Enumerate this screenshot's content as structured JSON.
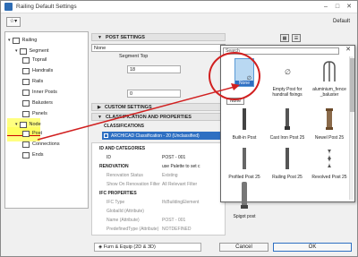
{
  "window": {
    "title": "Railing Default Settings",
    "default_label": "Default",
    "minimize": "–",
    "maximize": "□",
    "close": "✕"
  },
  "tree": {
    "items": [
      {
        "label": "Railing",
        "level": 0
      },
      {
        "label": "Segment",
        "level": 1
      },
      {
        "label": "Toprail",
        "level": 2
      },
      {
        "label": "Handrails",
        "level": 2
      },
      {
        "label": "Rails",
        "level": 2
      },
      {
        "label": "Inner Posts",
        "level": 2
      },
      {
        "label": "Balusters",
        "level": 2
      },
      {
        "label": "Panels",
        "level": 2
      },
      {
        "label": "Node",
        "level": 1
      },
      {
        "label": "Post",
        "level": 2
      },
      {
        "label": "Connections",
        "level": 2
      },
      {
        "label": "Ends",
        "level": 2
      }
    ]
  },
  "main": {
    "post_settings": "POST SETTINGS",
    "selected_post": "None",
    "segment_top_label": "Segment Top",
    "segment_top_value": "18",
    "offset_value": "0",
    "custom_settings": "CUSTOM SETTINGS",
    "classification_header": "CLASSIFICATION AND PROPERTIES",
    "classifications_label": "CLASSIFICATIONS",
    "classification_value": "ARCHICAD Classification - 20 (Unclassified)",
    "properties": [
      {
        "key": "ID AND CATEGORIES",
        "value": "",
        "type": "hd"
      },
      {
        "key": "ID",
        "value": "POST - 001",
        "type": "dark"
      },
      {
        "key": "RENOVATION",
        "value": "use Palette to set c",
        "type": "hd"
      },
      {
        "key": "Renovation Status",
        "value": "Existing",
        "type": "gray"
      },
      {
        "key": "Show On Renovation Filter",
        "value": "All Relevant Filter",
        "type": "gray"
      },
      {
        "key": "IFC PROPERTIES",
        "value": "",
        "type": "hd"
      },
      {
        "key": "IFC Type",
        "value": "IfcBuildingElement",
        "type": "gray"
      },
      {
        "key": "GlobalId (Attribute)",
        "value": "",
        "type": "gray"
      },
      {
        "key": "Name (Attribute)",
        "value": "POST - 001",
        "type": "gray"
      },
      {
        "key": "PredefinedType (Attribute)",
        "value": "NOTDEFINED",
        "type": "gray"
      }
    ]
  },
  "bottom": {
    "layer": "Furn & Equip (2D & 3D)",
    "cancel": "Cancel",
    "ok": "OK"
  },
  "library_popup": {
    "search_placeholder": "Search",
    "close": "✕",
    "tooltip": "None",
    "items": [
      {
        "label": "None",
        "icon": "none-icon"
      },
      {
        "label": "Empty Post for handrail fixings",
        "icon": "empty-post-icon"
      },
      {
        "label": "aluminium_fence _baluster",
        "icon": "baluster-icon"
      },
      {
        "label": "Built-in Post",
        "icon": "builtin-post-icon"
      },
      {
        "label": "Cast Iron Post 25",
        "icon": "cast-iron-post-icon"
      },
      {
        "label": "Newel Post 25",
        "icon": "newel-post-icon"
      },
      {
        "label": "Profiled Post 25",
        "icon": "profiled-post-icon"
      },
      {
        "label": "Railing Post 25",
        "icon": "railing-post-icon"
      },
      {
        "label": "Revolved Post 25",
        "icon": "revolved-post-icon"
      },
      {
        "label": "Spigot post",
        "icon": "spigot-post-icon"
      }
    ]
  },
  "colors": {
    "highlight": "#ffff60",
    "selection": "#2e6fc2",
    "annotation": "#d12020"
  }
}
